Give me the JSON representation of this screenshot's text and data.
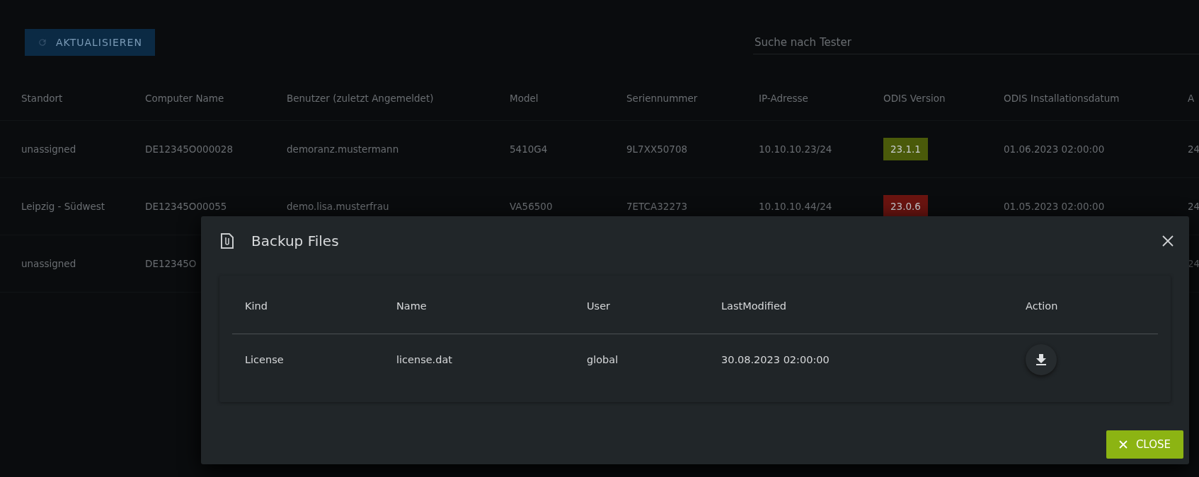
{
  "toolbar": {
    "refresh_button": "AKTUALISIEREN",
    "search": {
      "placeholder": "Suche nach Tester"
    }
  },
  "table": {
    "columns": [
      "Standort",
      "Computer Name",
      "Benutzer (zuletzt Angemeldet)",
      "Model",
      "Seriennummer",
      "IP-Adresse",
      "ODIS Version",
      "ODIS Installationsdatum",
      "A"
    ],
    "rows": [
      {
        "cells": [
          "unassigned",
          "DE12345O000028",
          "demoranz.mustermann",
          "5410G4",
          "9L7XX50708",
          "10.10.10.23/24",
          "23.1.1",
          "01.06.2023 02:00:00",
          "24"
        ],
        "color": "#4a5a0a"
      },
      {
        "cells": [
          "Leipzig - Südwest",
          "DE12345O00055",
          "demo.lisa.musterfrau",
          "VA56500",
          "7ETCA32273",
          "10.10.10.44/24",
          "23.0.6",
          "01.05.2023 02:00:00",
          "24"
        ],
        "color": "#6a1410"
      },
      {
        "cells": [
          "unassigned",
          "DE12345O",
          "",
          "",
          "",
          "",
          "",
          "",
          "24"
        ]
      }
    ]
  },
  "dialog": {
    "title": "Backup Files",
    "table": {
      "columns": [
        "Kind",
        "Name",
        "User",
        "LastModified",
        "Action"
      ],
      "rows": [
        {
          "kind": "License",
          "name": "license.dat",
          "user": "global",
          "last_modified": "30.08.2023 02:00:00"
        }
      ]
    },
    "close_button": "CLOSE"
  }
}
